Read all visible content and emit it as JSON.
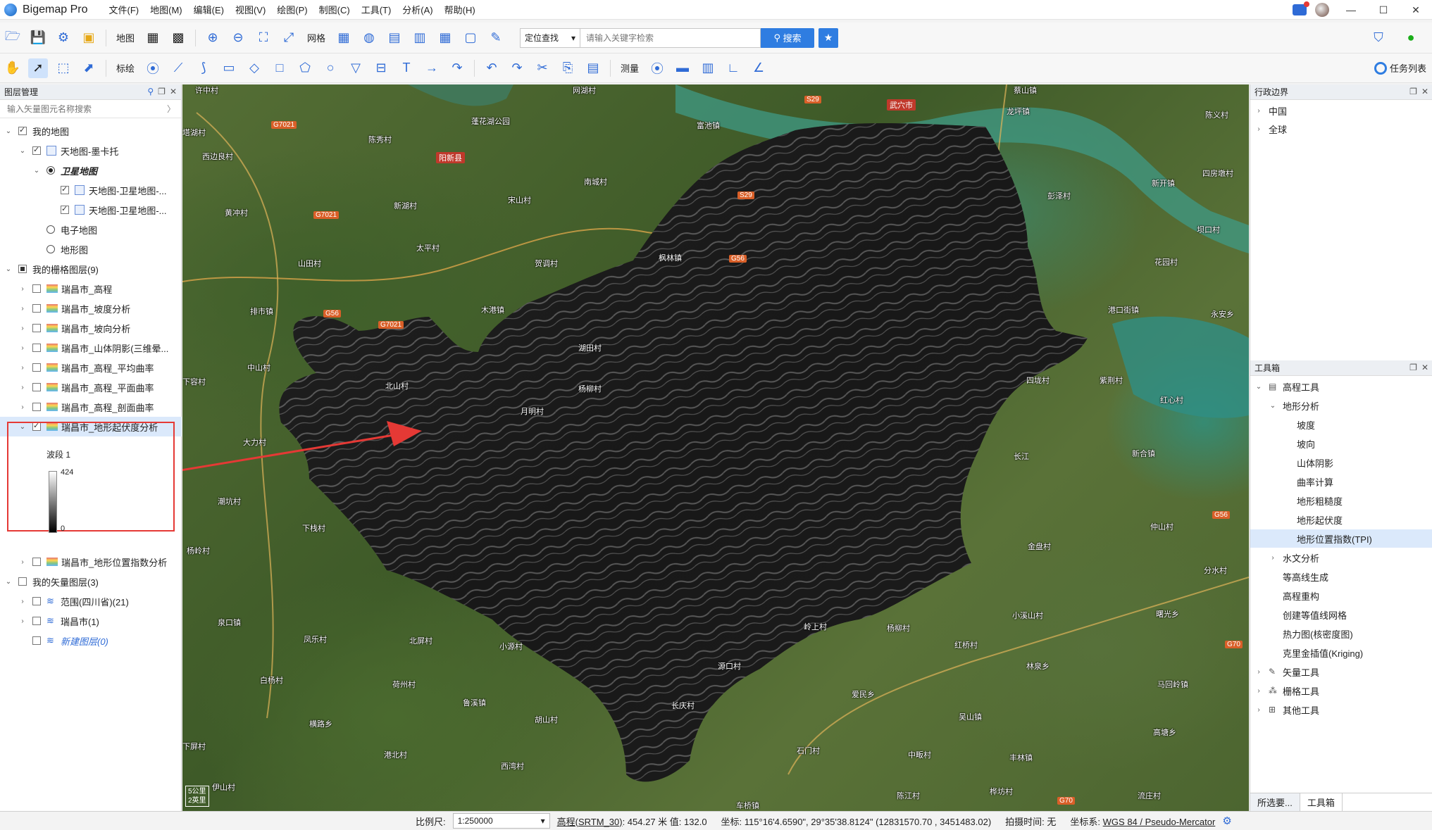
{
  "app": {
    "name": "Bigemap Pro"
  },
  "menu": [
    "文件(F)",
    "地图(M)",
    "编辑(E)",
    "视图(V)",
    "绘图(P)",
    "制图(C)",
    "工具(T)",
    "分析(A)",
    "帮助(H)"
  ],
  "toolbar1": {
    "map_label": "地图",
    "grid_label": "网格",
    "search_type": "定位查找",
    "search_placeholder": "请输入关键字检索",
    "search_button": "搜索"
  },
  "toolbar2": {
    "mark_label": "标绘",
    "measure_label": "测量",
    "task_list": "任务列表"
  },
  "layer_panel": {
    "title": "图层管理",
    "search_placeholder": "输入矢量图元名称搜索",
    "rows": [
      "我的地图",
      "天地图-墨卡托",
      "卫星地图",
      "天地图-卫星地图-...",
      "天地图-卫星地图-...",
      "电子地图",
      "地形图",
      "我的栅格图层(9)",
      "瑞昌市_高程",
      "瑞昌市_坡度分析",
      "瑞昌市_坡向分析",
      "瑞昌市_山体阴影(三维晕...",
      "瑞昌市_高程_平均曲率",
      "瑞昌市_高程_平面曲率",
      "瑞昌市_高程_剖面曲率",
      "瑞昌市_地形起伏度分析",
      "瑞昌市_地形位置指数分析",
      "我的矢量图层(3)",
      "范围(四川省)(21)",
      "瑞昌市(1)",
      "新建图层(0)"
    ],
    "legend": {
      "band": "波段 1",
      "max": "424",
      "min": "0"
    }
  },
  "map": {
    "places": [
      "许中村",
      "塔湖村",
      "网湖村",
      "蔡山镇",
      "陈秀村",
      "西边良村",
      "富池镇",
      "武穴市",
      "龙坪镇",
      "陈义村",
      "阳新县",
      "南城村",
      "彭泽村",
      "四房墩村",
      "新湖村",
      "宋山村",
      "新开镇",
      "黄冲村",
      "太平村",
      "坝口村",
      "山田村",
      "贺调村",
      "枫林镇",
      "花园村",
      "排市镇",
      "木港镇",
      "港口街镇",
      "永安乡",
      "湖田村",
      "中山村",
      "北山村",
      "杨柳村",
      "四垅村",
      "紫荆村",
      "红心村",
      "下容村",
      "大力村",
      "月明村",
      "新合镇",
      "潮坑村",
      "下栈村",
      "仲山村",
      "杨岭村",
      "金盘村",
      "分水村",
      "泉口镇",
      "凤乐村",
      "北屏村",
      "小源村",
      "岭上村",
      "杨柳村",
      "红桥村",
      "小溪山村",
      "曙光乡",
      "源口村",
      "林泉乡",
      "白杨村",
      "荷州村",
      "鲁溪镇",
      "长庆村",
      "爱民乡",
      "马回岭镇",
      "横路乡",
      "胡山村",
      "吴山镇",
      "高塘乡",
      "下屏村",
      "港北村",
      "西湾村",
      "石门村",
      "中畈村",
      "丰林镇",
      "伊山村",
      "车桥镇",
      "陈江村",
      "桦坊村",
      "流庄村"
    ],
    "roads": [
      "G7021",
      "S29",
      "S29",
      "G7021",
      "G56",
      "G56",
      "G7021",
      "G56",
      "G70",
      "G70"
    ],
    "cities": [
      "武穴市",
      "阳新县"
    ],
    "water_labels": [
      "蓬花湖公园",
      "长江"
    ],
    "scale_km": "5公里",
    "scale_mi": "2英里"
  },
  "admin_panel": {
    "title": "行政边界",
    "items": [
      "中国",
      "全球"
    ]
  },
  "toolbox": {
    "title": "工具箱",
    "rows": [
      "高程工具",
      "地形分析",
      "坡度",
      "坡向",
      "山体阴影",
      "曲率计算",
      "地形粗糙度",
      "地形起伏度",
      "地形位置指数(TPI)",
      "水文分析",
      "等高线生成",
      "高程重构",
      "创建等值线网格",
      "热力图(核密度图)",
      "克里金插值(Kriging)",
      "矢量工具",
      "栅格工具",
      "其他工具"
    ],
    "tabs": [
      "所选要...",
      "工具箱"
    ]
  },
  "status": {
    "scale_label": "比例尺:",
    "scale_value": "1:250000",
    "elev_label": "高程(SRTM_30)",
    "elev_value": ": 454.27 米 值: 132.0",
    "coord_label": "坐标:",
    "coord_value": "115°16'4.6590\", 29°35'38.8124\"   (12831570.70 , 3451483.02)",
    "shot_time": "拍摄时间: 无",
    "crs_label": "坐标系:",
    "crs_value": "WGS 84 / Pseudo-Mercator"
  }
}
